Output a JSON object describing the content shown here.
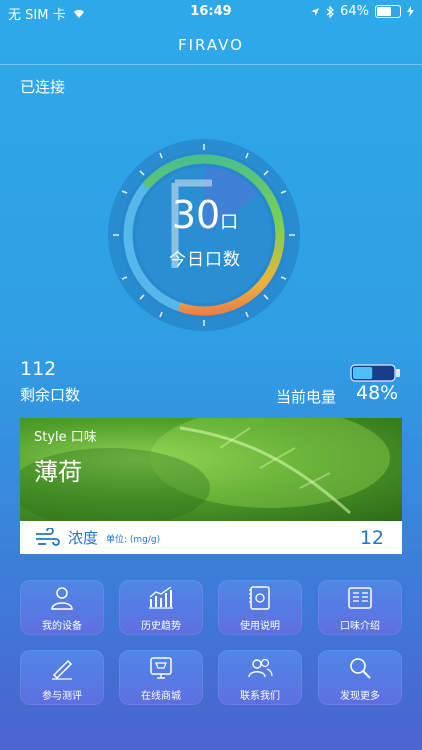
{
  "statusbar": {
    "carrier": "无 SIM 卡",
    "time": "16:49",
    "battery": "64%"
  },
  "navbar": {
    "brand": "FIRAVO"
  },
  "connection_status": "已连接",
  "gauge": {
    "count": "30",
    "unit": "口",
    "label": "今日口数"
  },
  "remaining": {
    "value": "112",
    "label": "剩余口数"
  },
  "battery": {
    "label": "当前电量",
    "percent": "48%",
    "level": 0.48
  },
  "flavor_card": {
    "style_label": "Style 口味",
    "flavor": "薄荷",
    "concentration_label": "浓度",
    "unit_label": "单位: (mg/g)",
    "concentration_value": "12"
  },
  "menu": [
    {
      "label": "我的设备",
      "icon": "user-icon"
    },
    {
      "label": "历史趋势",
      "icon": "chart-icon"
    },
    {
      "label": "使用说明",
      "icon": "manual-icon"
    },
    {
      "label": "口味介绍",
      "icon": "flavor-card-icon"
    },
    {
      "label": "参与测评",
      "icon": "pen-icon"
    },
    {
      "label": "在线商城",
      "icon": "shop-icon"
    },
    {
      "label": "联系我们",
      "icon": "contacts-icon"
    },
    {
      "label": "发现更多",
      "icon": "search-icon"
    }
  ]
}
